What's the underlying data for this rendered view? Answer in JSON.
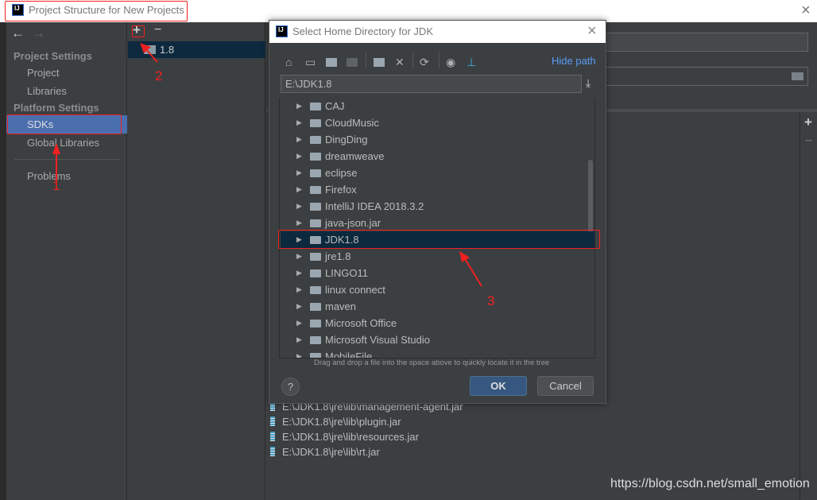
{
  "window": {
    "title": "Project Structure for New Projects",
    "icon": "intellij-icon",
    "close": "×"
  },
  "sidebar": {
    "back": "←",
    "forward": "→",
    "section1": "Project Settings",
    "items1": [
      "Project",
      "Libraries"
    ],
    "section2": "Platform Settings",
    "items2": [
      "SDKs",
      "Global Libraries"
    ],
    "problems": "Problems",
    "selected": "SDKs"
  },
  "sdk_list": {
    "add": "+",
    "remove": "−",
    "items": [
      "1.8"
    ]
  },
  "right_panel": {
    "add": "+",
    "remove": "−",
    "classpath": [
      "E:\\JDK1.8\\jre\\lib\\management-agent.jar",
      "E:\\JDK1.8\\jre\\lib\\plugin.jar",
      "E:\\JDK1.8\\jre\\lib\\resources.jar",
      "E:\\JDK1.8\\jre\\lib\\rt.jar"
    ]
  },
  "dialog": {
    "title": "Select Home Directory for JDK",
    "close": "×",
    "hide_path": "Hide path",
    "toolbar": [
      "home-icon",
      "desktop-icon",
      "project-folder-icon",
      "module-folder-icon",
      "new-folder-icon",
      "delete-icon",
      "refresh-icon",
      "show-hidden-icon",
      "jdk-icon"
    ],
    "path": "E:\\JDK1.8",
    "tree": [
      "CAJ",
      "CloudMusic",
      "DingDing",
      "dreamweave",
      "eclipse",
      "Firefox",
      "IntelliJ IDEA 2018.3.2",
      "java-json.jar",
      "JDK1.8",
      "jre1.8",
      "LINGO11",
      "linux connect",
      "maven",
      "Microsoft Office",
      "Microsoft Visual Studio",
      "MobileFile"
    ],
    "selected": "JDK1.8",
    "hint": "Drag and drop a file into the space above to quickly locate it in the tree",
    "help": "?",
    "ok": "OK",
    "cancel": "Cancel"
  },
  "annotations": [
    "1",
    "2",
    "3"
  ],
  "watermark": "https://blog.csdn.net/small_emotion",
  "colors": {
    "accent": "#4b6eaf",
    "selection": "#0d293e",
    "annotation": "#f02020",
    "link": "#589df6"
  }
}
